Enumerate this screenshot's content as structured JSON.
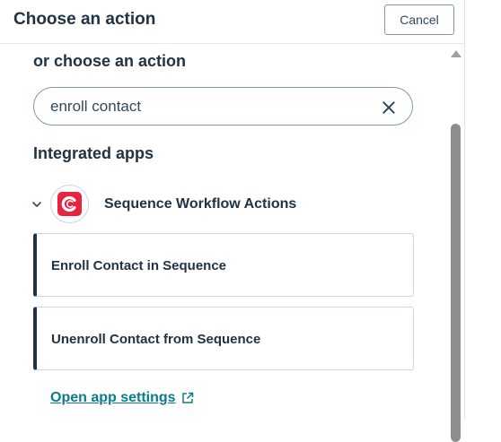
{
  "header": {
    "title": "Choose an action",
    "cancel_label": "Cancel"
  },
  "main": {
    "section_title": "or choose an action",
    "search": {
      "value": "enroll contact",
      "clear_icon": "close-icon"
    },
    "group_title": "Integrated apps",
    "app": {
      "name": "Sequence Workflow Actions",
      "logo_color": "#e8233f",
      "expanded": true
    },
    "actions": [
      {
        "label": "Enroll Contact in Sequence"
      },
      {
        "label": "Unenroll Contact from Sequence"
      }
    ],
    "settings_link": "Open app settings"
  },
  "colors": {
    "accent_link": "#0b7b8b",
    "text_dark": "#213343",
    "border": "#cbd6e2"
  }
}
